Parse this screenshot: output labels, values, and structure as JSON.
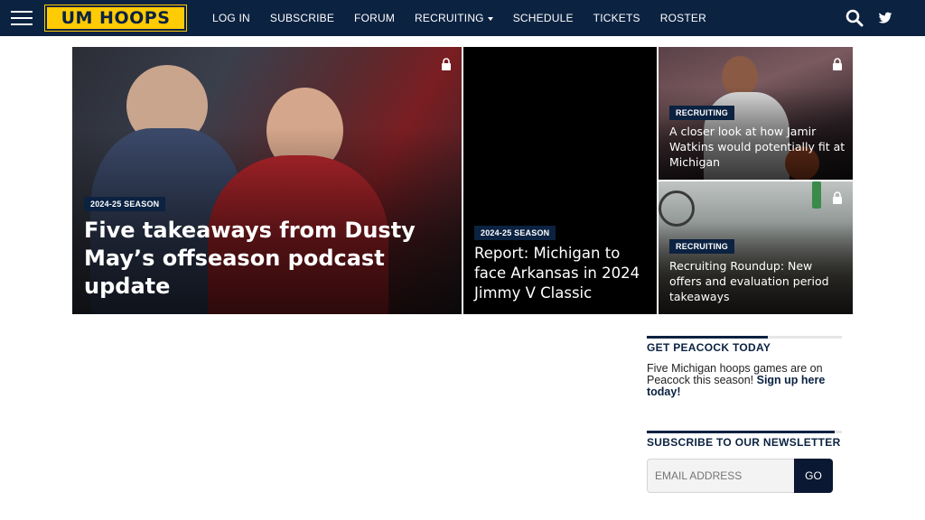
{
  "nav": {
    "logo": "UM HOOPS",
    "links": [
      {
        "label": "LOG IN"
      },
      {
        "label": "SUBSCRIBE"
      },
      {
        "label": "FORUM"
      },
      {
        "label": "RECRUITING",
        "has_dropdown": true
      },
      {
        "label": "SCHEDULE"
      },
      {
        "label": "TICKETS"
      },
      {
        "label": "ROSTER"
      }
    ],
    "icons": [
      "hamburger-icon",
      "search-icon",
      "twitter-icon"
    ]
  },
  "hero": {
    "main": {
      "tag": "2024-25 SEASON",
      "headline": "Five takeaways from Dusty May’s offseason podcast update",
      "locked": true
    },
    "middle": {
      "tag": "2024-25 SEASON",
      "headline": "Report: Michigan to face Arkansas in 2024 Jimmy V Classic",
      "locked": false
    },
    "top_right": {
      "tag": "RECRUITING",
      "headline": "A closer look at how Jamir Watkins would potentially fit at Michigan",
      "locked": true
    },
    "bottom_right": {
      "tag": "RECRUITING",
      "headline": "Recruiting Roundup: New offers and evaluation period takeaways",
      "locked": true
    }
  },
  "sidebar": {
    "peacock": {
      "title": "GET PEACOCK TODAY",
      "text": "Five Michigan hoops games are on Peacock this season!",
      "link": "Sign up here today!"
    },
    "newsletter": {
      "title": "SUBSCRIBE TO OUR NEWSLETTER",
      "email_placeholder": "EMAIL ADDRESS",
      "button": "GO"
    }
  },
  "colors": {
    "navy": "#0b2241",
    "maize": "#ffcb05"
  }
}
